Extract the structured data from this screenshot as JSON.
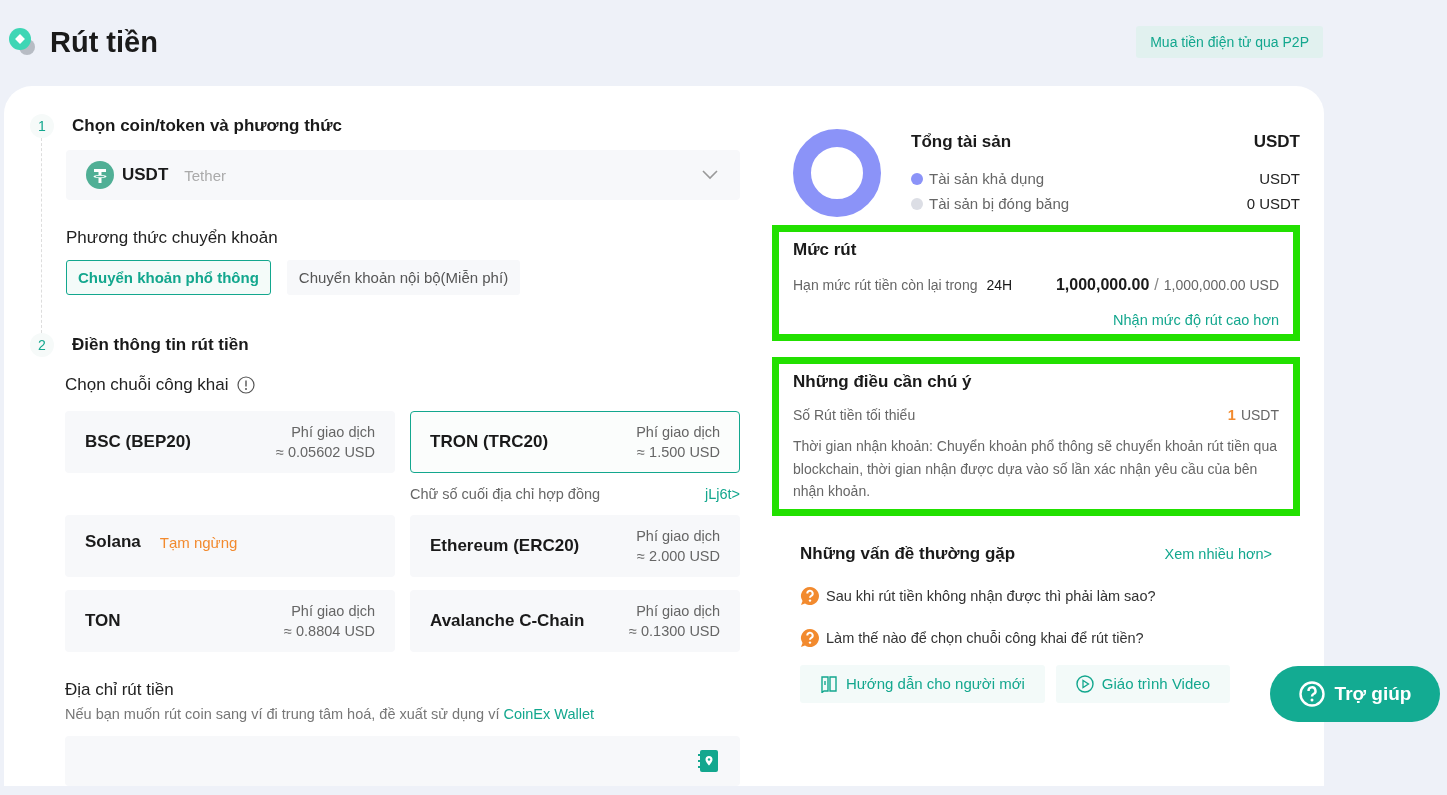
{
  "header": {
    "title": "Rút tiền",
    "p2p_button": "Mua tiền điện tử qua P2P"
  },
  "steps": [
    {
      "number": "1",
      "title": "Chọn coin/token và phương thức"
    },
    {
      "number": "2",
      "title": "Điền thông tin rút tiền"
    }
  ],
  "coin_select": {
    "symbol": "USDT",
    "name": "Tether"
  },
  "transfer_method": {
    "label": "Phương thức chuyển khoản",
    "options": [
      {
        "label": "Chuyển khoản phổ thông",
        "selected": true
      },
      {
        "label": "Chuyển khoản nội bộ(Miễn phí)",
        "selected": false
      }
    ]
  },
  "chain": {
    "label": "Chọn chuỗi công khai",
    "options": [
      {
        "name": "BSC (BEP20)",
        "fee_label": "Phí giao dịch",
        "fee": "≈ 0.05602 USD",
        "selected": false
      },
      {
        "name": "TRON (TRC20)",
        "fee_label": "Phí giao dịch",
        "fee": "≈ 1.500 USD",
        "selected": true
      },
      {
        "name": "Solana",
        "status": "Tạm ngừng",
        "selected": false
      },
      {
        "name": "Ethereum (ERC20)",
        "fee_label": "Phí giao dịch",
        "fee": "≈ 2.000 USD",
        "selected": false
      },
      {
        "name": "TON",
        "fee_label": "Phí giao dịch",
        "fee": "≈ 0.8804 USD",
        "selected": false
      },
      {
        "name": "Avalanche C-Chain",
        "fee_label": "Phí giao dịch",
        "fee": "≈ 0.1300 USD",
        "selected": false
      }
    ],
    "contract_hint": {
      "label": "Chữ số cuối địa chỉ hợp đồng",
      "value": "jLj6t>"
    }
  },
  "address": {
    "label": "Địa chỉ rút tiền",
    "hint": "Nếu bạn muốn rút coin sang ví đi trung tâm hoá, đề xuất sử dụng ví",
    "hint_link": "CoinEx Wallet"
  },
  "assets": {
    "title": "Tổng tài sản",
    "unit": "USDT",
    "rows": [
      {
        "label": "Tài sản khả dụng",
        "value": "USDT",
        "color": "#8b93f8"
      },
      {
        "label": "Tài sản bị đóng băng",
        "value": "0 USDT",
        "color": "#dcdee5"
      }
    ]
  },
  "limit": {
    "title": "Mức rút",
    "highlighted": true,
    "label": "Hạn mức rút tiền còn lại trong",
    "period": "24H",
    "remaining": "1,000,000.00",
    "separator": "/",
    "total": "1,000,000.00 USD",
    "link": "Nhận mức độ rút cao hơn"
  },
  "notes": {
    "title": "Những điều cần chú ý",
    "highlighted": true,
    "min_label": "Số Rút tiền tối thiểu",
    "min_amount": "1",
    "min_unit": "USDT",
    "text": "Thời gian nhận khoản: Chuyển khoản phổ thông sẽ chuyển khoản rút tiền qua blockchain, thời gian nhận được dựa vào số lần xác nhận yêu cầu của bên nhận khoản."
  },
  "faq": {
    "title": "Những vấn đề thường gặp",
    "more": "Xem nhiều hơn>",
    "questions": [
      "Sau khi rút tiền không nhận được thì phải làm sao?",
      "Làm thế nào để chọn chuỗi công khai để rút tiền?"
    ],
    "buttons": [
      {
        "kind": "guide",
        "label": "Hướng dẫn cho người mới"
      },
      {
        "kind": "video",
        "label": "Giáo trình Video"
      }
    ]
  },
  "help_button": {
    "label": "Trợ giúp"
  }
}
